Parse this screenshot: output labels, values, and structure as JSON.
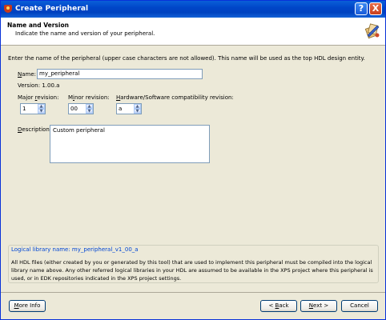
{
  "window": {
    "title": "Create Peripheral",
    "help_icon": "?",
    "close_icon": "X"
  },
  "header": {
    "title": "Name and Version",
    "subtitle": "Indicate the name and version of your peripheral."
  },
  "intro": "Enter the name of the peripheral (upper case characters are not allowed). This name will be used as the top HDL design entity.",
  "name": {
    "label_prefix": "N",
    "label_rest": "ame:",
    "value": "my_peripheral"
  },
  "version": {
    "text": "Version: 1.00.a"
  },
  "major": {
    "label_prefix": "Major ",
    "label_ul": "r",
    "label_rest": "evision:",
    "value": "1"
  },
  "minor": {
    "label_prefix": "M",
    "label_ul": "i",
    "label_rest": "nor revision:",
    "value": "00"
  },
  "compat": {
    "label_prefix": "",
    "label_ul": "H",
    "label_rest": "ardware/Software compatibility revision:",
    "value": "a"
  },
  "description": {
    "label_prefix": "",
    "label_ul": "D",
    "label_rest": "escription:",
    "value": "Custom peripheral"
  },
  "library": {
    "name": "Logical library name: my_peripheral_v1_00_a",
    "note": "All HDL files (either created by you or generated by this tool) that are used to implement this peripheral must be compiled into the logical library name above. Any other referred logical libraries in your HDL are assumed to be available in the XPS project where this peripheral is used, or in EDK repositories indicated in the XPS project settings."
  },
  "buttons": {
    "more_info_ul": "M",
    "more_info_rest": "ore Info",
    "back_prefix": "< ",
    "back_ul": "B",
    "back_rest": "ack",
    "next_ul": "N",
    "next_rest": "ext >",
    "cancel": "Cancel"
  }
}
